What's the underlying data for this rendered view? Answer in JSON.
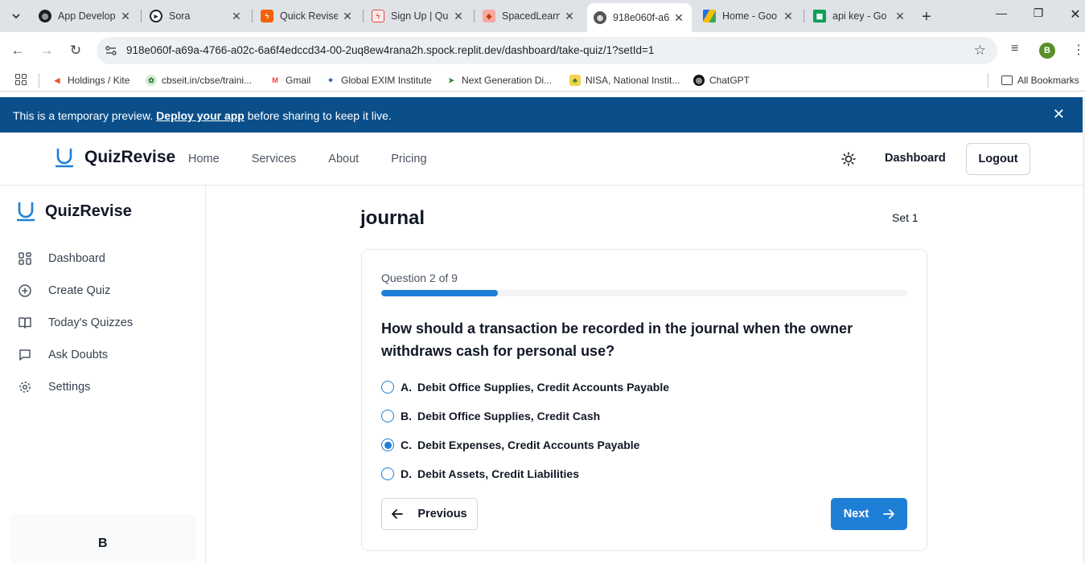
{
  "browser": {
    "tabs": [
      {
        "title": "App Develop",
        "active": false
      },
      {
        "title": "Sora",
        "active": false
      },
      {
        "title": "Quick Revise",
        "active": false
      },
      {
        "title": "Sign Up | Qu",
        "active": false
      },
      {
        "title": "SpacedLearn",
        "active": false
      },
      {
        "title": "918e060f-a6",
        "active": true
      },
      {
        "title": "Home - Goo",
        "active": false
      },
      {
        "title": "api key - Go",
        "active": false
      }
    ],
    "url": "918e060f-a69a-4766-a02c-6a6f4edccd34-00-2uq8ew4rana2h.spock.replit.dev/dashboard/take-quiz/1?setId=1",
    "profile_initial": "B",
    "bookmarks": [
      {
        "label": "Holdings / Kite"
      },
      {
        "label": "cbseit.in/cbse/traini..."
      },
      {
        "label": "Gmail"
      },
      {
        "label": "Global EXIM Institute"
      },
      {
        "label": "Next Generation Di..."
      },
      {
        "label": "NISA, National Instit..."
      },
      {
        "label": "ChatGPT"
      }
    ],
    "all_bookmarks_label": "All Bookmarks"
  },
  "banner": {
    "prefix": "This is a temporary preview. ",
    "link": "Deploy your app",
    "suffix": " before sharing to keep it live."
  },
  "header": {
    "brand": "QuizRevise",
    "nav": [
      "Home",
      "Services",
      "About",
      "Pricing"
    ],
    "dashboard_label": "Dashboard",
    "logout_label": "Logout"
  },
  "sidebar": {
    "brand": "QuizRevise",
    "items": [
      {
        "label": "Dashboard",
        "icon": "grid-icon"
      },
      {
        "label": "Create Quiz",
        "icon": "plus-circle-icon"
      },
      {
        "label": "Today's Quizzes",
        "icon": "book-open-icon"
      },
      {
        "label": "Ask Doubts",
        "icon": "message-square-icon"
      },
      {
        "label": "Settings",
        "icon": "gear-icon"
      }
    ],
    "user_initial": "B"
  },
  "quiz": {
    "title": "journal",
    "set_label": "Set 1",
    "progress_text": "Question 2 of 9",
    "progress_fraction": 0.222,
    "question": "How should a transaction be recorded in the journal when the owner withdraws cash for personal use?",
    "options": [
      {
        "letter": "A.",
        "text": "Debit Office Supplies, Credit Accounts Payable",
        "selected": false
      },
      {
        "letter": "B.",
        "text": "Debit Office Supplies, Credit Cash",
        "selected": false
      },
      {
        "letter": "C.",
        "text": "Debit Expenses, Credit Accounts Payable",
        "selected": true
      },
      {
        "letter": "D.",
        "text": "Debit Assets, Credit Liabilities",
        "selected": false
      }
    ],
    "previous_label": "Previous",
    "next_label": "Next"
  },
  "colors": {
    "accent": "#1f7fd6",
    "banner": "#0b4f8a"
  }
}
